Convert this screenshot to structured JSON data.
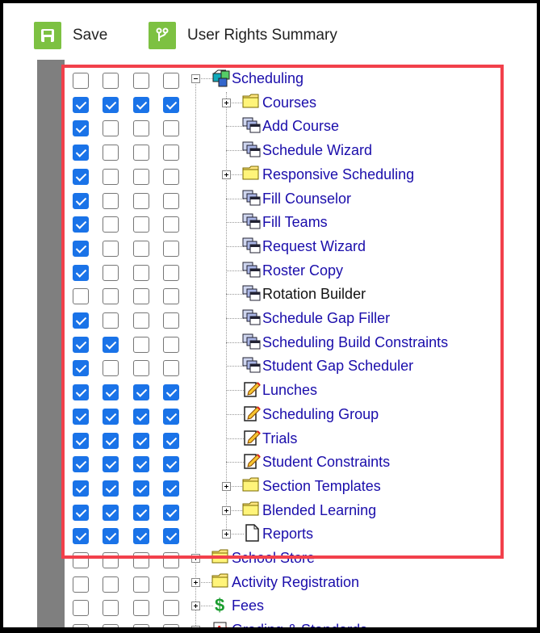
{
  "toolbar": {
    "save_label": "Save",
    "rights_label": "User Rights Summary"
  },
  "tree": {
    "root_label": "Scheduling",
    "root_checks": [
      false,
      false,
      false,
      false
    ],
    "items": [
      {
        "label": "Courses",
        "icon": "folder-icon",
        "expand": true,
        "checks": [
          true,
          true,
          true,
          true
        ]
      },
      {
        "label": "Add Course",
        "icon": "tool-icon",
        "expand": false,
        "checks": [
          true,
          false,
          false,
          false
        ]
      },
      {
        "label": "Schedule Wizard",
        "icon": "tool-icon",
        "expand": false,
        "checks": [
          true,
          false,
          false,
          false
        ]
      },
      {
        "label": "Responsive Scheduling",
        "icon": "folder-icon",
        "expand": true,
        "checks": [
          true,
          false,
          false,
          false
        ]
      },
      {
        "label": "Fill Counselor",
        "icon": "tool-icon",
        "expand": false,
        "checks": [
          true,
          false,
          false,
          false
        ]
      },
      {
        "label": "Fill Teams",
        "icon": "tool-icon",
        "expand": false,
        "checks": [
          true,
          false,
          false,
          false
        ]
      },
      {
        "label": "Request Wizard",
        "icon": "tool-icon",
        "expand": false,
        "checks": [
          true,
          false,
          false,
          false
        ]
      },
      {
        "label": "Roster Copy",
        "icon": "tool-icon",
        "expand": false,
        "checks": [
          true,
          false,
          false,
          false
        ]
      },
      {
        "label": "Rotation Builder",
        "icon": "tool-icon",
        "expand": false,
        "checks": [
          false,
          false,
          false,
          false
        ],
        "black": true
      },
      {
        "label": "Schedule Gap Filler",
        "icon": "tool-icon",
        "expand": false,
        "checks": [
          true,
          false,
          false,
          false
        ]
      },
      {
        "label": "Scheduling Build Constraints",
        "icon": "tool-icon",
        "expand": false,
        "checks": [
          true,
          true,
          false,
          false
        ]
      },
      {
        "label": "Student Gap Scheduler",
        "icon": "tool-icon",
        "expand": false,
        "checks": [
          true,
          false,
          false,
          false
        ]
      },
      {
        "label": "Lunches",
        "icon": "edit-icon",
        "expand": false,
        "checks": [
          true,
          true,
          true,
          true
        ]
      },
      {
        "label": "Scheduling Group",
        "icon": "edit-icon",
        "expand": false,
        "checks": [
          true,
          true,
          true,
          true
        ]
      },
      {
        "label": "Trials",
        "icon": "edit-icon",
        "expand": false,
        "checks": [
          true,
          true,
          true,
          true
        ]
      },
      {
        "label": "Student Constraints",
        "icon": "edit-icon",
        "expand": false,
        "checks": [
          true,
          true,
          true,
          true
        ]
      },
      {
        "label": "Section Templates",
        "icon": "folder-icon",
        "expand": true,
        "checks": [
          true,
          true,
          true,
          true
        ]
      },
      {
        "label": "Blended Learning",
        "icon": "folder-icon",
        "expand": true,
        "checks": [
          true,
          true,
          true,
          true
        ]
      },
      {
        "label": "Reports",
        "icon": "document-icon",
        "expand": true,
        "checks": [
          true,
          true,
          true,
          true
        ]
      }
    ],
    "siblings": [
      {
        "label": "School Store",
        "icon": "folder-icon",
        "checks": [
          false,
          false,
          false,
          false
        ]
      },
      {
        "label": "Activity Registration",
        "icon": "folder-icon",
        "checks": [
          false,
          false,
          false,
          false
        ]
      },
      {
        "label": "Fees",
        "icon": "dollar-icon",
        "checks": [
          false,
          false,
          false,
          false
        ]
      },
      {
        "label": "Grading & Standards",
        "icon": "grade-icon",
        "checks": [
          false,
          false,
          false,
          false
        ]
      }
    ]
  },
  "colors": {
    "accent": "#1a73e8",
    "link": "#1a0dab",
    "highlight": "#f2404b",
    "toolbar_icon": "#7dc142"
  }
}
